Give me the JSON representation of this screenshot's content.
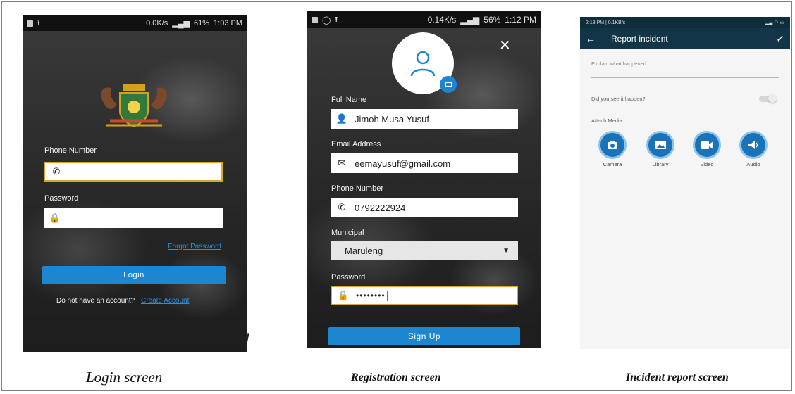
{
  "login": {
    "status": {
      "net": "0.0K/s",
      "battery": "61%",
      "time": "1:03 PM"
    },
    "phone_label": "Phone Number",
    "password_label": "Password",
    "forgot": "Forgot Password",
    "login_button": "Login",
    "no_account": "Do not have an account?",
    "create": "Create Account",
    "caption": "Login screen"
  },
  "register": {
    "status": {
      "net": "0.14K/s",
      "battery": "56%",
      "time": "1:12 PM"
    },
    "full_name_label": "Full Name",
    "full_name": "Jimoh Musa Yusuf",
    "email_label": "Email Address",
    "email": "eemayusuf@gmail.com",
    "phone_label": "Phone Number",
    "phone": "0792222924",
    "municipal_label": "Municipal",
    "municipal": "Maruleng",
    "password_label": "Password",
    "password": "••••••••",
    "signup": "Sign Up",
    "caption": "Registration screen"
  },
  "incident": {
    "status_time": "2:13 PM | 0.1KB/s",
    "title": "Report incident",
    "explain_placeholder": "Explain what happened",
    "see_it": "Did you see it happen?",
    "attach": "Attach Media",
    "media": [
      "Camera",
      "Library",
      "Video",
      "Audio"
    ],
    "caption": "Incident report screen"
  },
  "colors": {
    "accent": "#1d86d0",
    "appbar": "#123647"
  }
}
